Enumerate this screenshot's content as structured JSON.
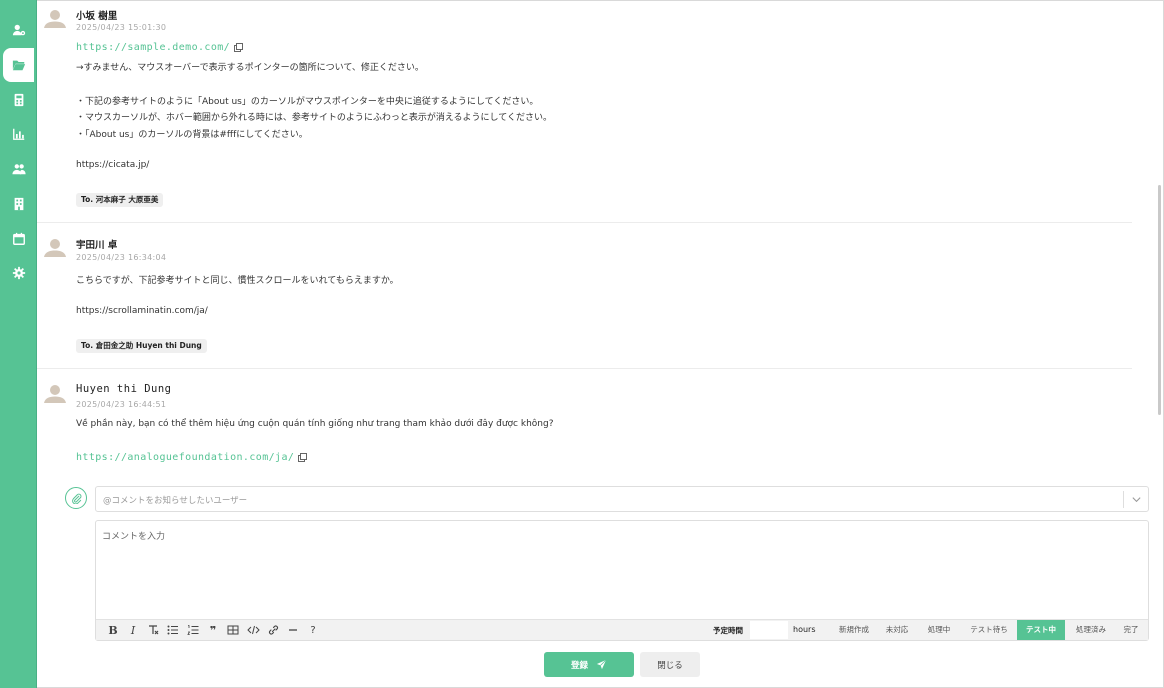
{
  "sidebar": {
    "accent_color": "#56c394",
    "items": [
      {
        "icon": "user-settings-icon"
      },
      {
        "icon": "folder-open-icon",
        "active": true
      },
      {
        "icon": "calculator-icon"
      },
      {
        "icon": "bar-chart-icon"
      },
      {
        "icon": "users-icon"
      },
      {
        "icon": "building-icon"
      },
      {
        "icon": "calendar-icon"
      },
      {
        "icon": "gear-icon"
      }
    ]
  },
  "comments": [
    {
      "author": "小坂 樹里",
      "timestamp": "2025/04/23 15:01:30",
      "link": "https://sample.demo.com/",
      "lines": [
        "→すみません、マウスオーバーで表示するポインターの箇所について、修正ください。",
        "・下記の参考サイトのように「About us」のカーソルがマウスポインターを中央に追従するようにしてください。",
        "・マウスカーソルが、ホバー範囲から外れる時には、参考サイトのようにふわっと表示が消えるようにしてください。",
        "・「About us」のカーソルの背景は#fffにしてください。",
        "https://cicata.jp/"
      ],
      "mention": "To. 河本麻子 大原亜美"
    },
    {
      "author": "宇田川 卓",
      "timestamp": "2025/04/23 16:34:04",
      "lines": [
        "こちらですが、下記参考サイトと同じ、慣性スクロールをいれてもらえますか。",
        "https://scrollaminatin.com/ja/"
      ],
      "mention": "To. 倉田金之助 Huyen thi Dung"
    },
    {
      "author": "Huyen thi Dung",
      "timestamp": "2025/04/23 16:44:51",
      "lines": [
        "Về phần này, bạn có thể thêm hiệu ứng cuộn quán tính giống như trang tham khảo dưới đây được không?"
      ],
      "link": "https://analoguefoundation.com/ja/"
    }
  ],
  "composer": {
    "mention_placeholder": "@コメントをお知らせしたいユーザー",
    "comment_placeholder": "コメントを入力",
    "toolbar_icons": [
      "bold-icon",
      "italic-icon",
      "clear-format-icon",
      "bullet-list-icon",
      "numbered-list-icon",
      "quote-icon",
      "table-icon",
      "code-icon",
      "link-icon",
      "horizontal-rule-icon",
      "help-icon"
    ],
    "toolbar_glyphs": {
      "bold": "B",
      "italic": "I",
      "help": "?",
      "quote": "❞"
    },
    "estimate_label": "予定時間",
    "estimate_value": "",
    "estimate_unit": "hours",
    "statuses": [
      "新規作成",
      "未対応",
      "処理中",
      "テスト待ち",
      "テスト中",
      "処理済み",
      "完了"
    ],
    "active_status": "テスト中"
  },
  "actions": {
    "submit_label": "登録",
    "close_label": "閉じる"
  }
}
